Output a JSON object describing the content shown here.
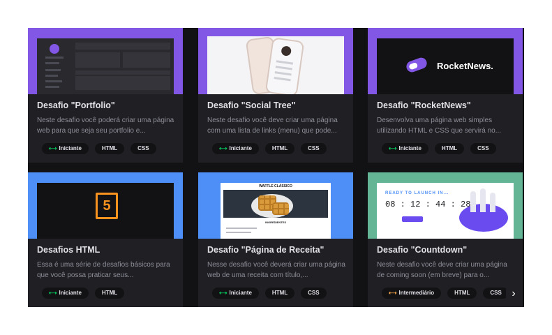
{
  "cards": [
    {
      "title": "Desafio \"Portfolio\"",
      "desc": "Neste desafio você poderá criar uma página web para que seja seu portfolio e...",
      "tags": [
        "Iniciante",
        "HTML",
        "CSS"
      ],
      "banner_color": "#8257e5"
    },
    {
      "title": "Desafio \"Social Tree\"",
      "desc": "Neste desafio você deve criar uma página com uma lista de links (menu) que pode...",
      "tags": [
        "Iniciante",
        "HTML",
        "CSS"
      ],
      "banner_color": "#8257e5"
    },
    {
      "title": "Desafio \"RocketNews\"",
      "desc": "Desenvolva uma página web simples utilizando HTML e CSS que servirá no...",
      "tags": [
        "Iniciante",
        "HTML",
        "CSS"
      ],
      "banner_color": "#8257e5",
      "banner_text": "RocketNews."
    },
    {
      "title": "Desafios HTML",
      "desc": "Essa é uma série de desafios básicos para que você possa praticar seus...",
      "tags": [
        "Iniciante",
        "HTML"
      ],
      "banner_color": "#4d8ef7",
      "banner_text": "5"
    },
    {
      "title": "Desafio \"Página de Receita\"",
      "desc": "Nesse desafio você deverá criar uma página web de uma receita com título,...",
      "tags": [
        "Iniciante",
        "HTML",
        "CSS"
      ],
      "banner_color": "#4d8ef7",
      "banner_text": "WAFFLE CLÁSSICO",
      "banner_subtext": "INGREDIENTES"
    },
    {
      "title": "Desafio \"Countdown\"",
      "desc": "Neste desafio você deve criar uma página de coming soon (em breve) para o...",
      "tags": [
        "Intermediário",
        "HTML",
        "CSS"
      ],
      "banner_color": "#63b596",
      "banner_text": "READY TO LAUNCH IN...",
      "banner_subtext": "08 : 12 : 44 : 28"
    }
  ],
  "level_icon": "⟷",
  "next_label": "›",
  "colors": {
    "iniciante": "#04d361",
    "intermediario": "#fba94c"
  }
}
